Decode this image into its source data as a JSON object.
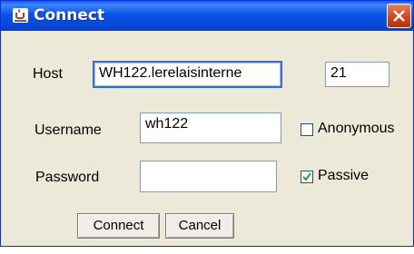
{
  "window": {
    "title": "Connect",
    "icon": "java-cup-icon",
    "close_icon": "close-x-icon"
  },
  "form": {
    "host_label": "Host",
    "host_value": "WH122.lerelaisinterne",
    "port_value": "21",
    "username_label": "Username",
    "username_value": "wh122",
    "anonymous_label": "Anonymous",
    "anonymous_checked": false,
    "password_label": "Password",
    "password_value": "",
    "passive_label": "Passive",
    "passive_checked": true
  },
  "buttons": {
    "connect": "Connect",
    "cancel": "Cancel"
  }
}
